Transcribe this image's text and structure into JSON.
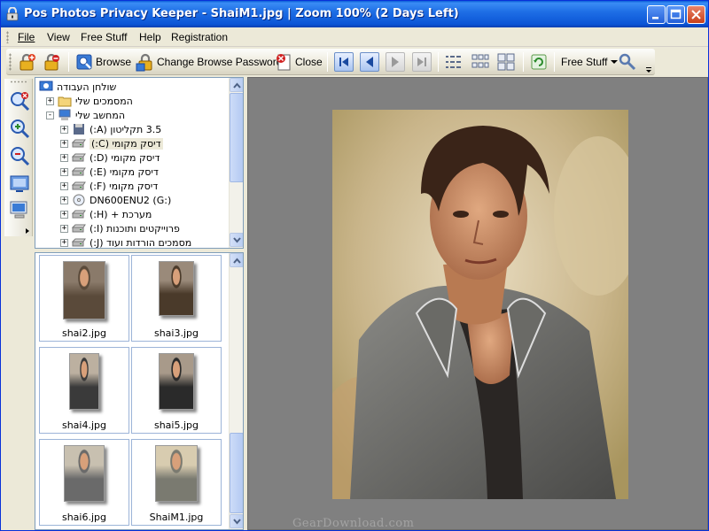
{
  "window": {
    "title": "Pos Photos Privacy Keeper - ShaiM1.jpg | Zoom 100% (2 Days Left)"
  },
  "menu": [
    {
      "label": "File",
      "hotkey_index": 0
    },
    {
      "label": "View",
      "hotkey_index": 0
    },
    {
      "label": "Free Stuff",
      "hotkey_index": 0
    },
    {
      "label": "Help",
      "hotkey_index": 0
    },
    {
      "label": "Registration",
      "hotkey_index": 0
    }
  ],
  "toolbar": {
    "browse_label": "Browse",
    "change_password_label": "Change Browse Password",
    "close_label": "Close",
    "free_stuff_label": "Free Stuff",
    "icons": [
      "lock-add-icon",
      "lock-remove-icon",
      "browse-icon",
      "change-password-icon",
      "close-doc-icon",
      "first-icon",
      "prev-icon",
      "next-icon",
      "last-icon",
      "list-view-icon",
      "thumbs-view-icon",
      "large-thumbs-icon",
      "refresh-icon",
      "tools-icon"
    ]
  },
  "side_toolbar": {
    "icons": [
      "zoom-fit-icon",
      "zoom-in-icon",
      "zoom-out-icon",
      "view-fullscreen-icon",
      "computer-icon"
    ]
  },
  "tree": {
    "items": [
      {
        "label": "שולחן העבודה",
        "icon": "desktop-icon",
        "expander": "",
        "level": 0
      },
      {
        "label": "המסמכים שלי",
        "icon": "folder-icon",
        "expander": "+",
        "level": 1
      },
      {
        "label": "המחשב שלי",
        "icon": "computer-icon",
        "expander": "-",
        "level": 1
      },
      {
        "label": "3.5 תקליטון (A:)",
        "icon": "floppy-icon",
        "expander": "+",
        "level": 2
      },
      {
        "label": "דיסק מקומי (C:)",
        "icon": "drive-icon",
        "expander": "+",
        "level": 2,
        "selected": true
      },
      {
        "label": "דיסק מקומי (D:)",
        "icon": "drive-icon",
        "expander": "+",
        "level": 2
      },
      {
        "label": "דיסק מקומי (E:)",
        "icon": "drive-icon",
        "expander": "+",
        "level": 2
      },
      {
        "label": "דיסק מקומי (F:)",
        "icon": "drive-icon",
        "expander": "+",
        "level": 2
      },
      {
        "label": "DN600ENU2 (G:)",
        "icon": "cd-icon",
        "expander": "+",
        "level": 2
      },
      {
        "label": "מערכת + (H:)",
        "icon": "drive-icon",
        "expander": "+",
        "level": 2
      },
      {
        "label": "פרוייקטים ותוכנות (I:)",
        "icon": "drive-icon",
        "expander": "+",
        "level": 2
      },
      {
        "label": "מסמכים הורדות ועוד (J:)",
        "icon": "drive-icon",
        "expander": "+",
        "level": 2
      }
    ]
  },
  "thumbnails": [
    {
      "name": "shai2.jpg"
    },
    {
      "name": "shai3.jpg"
    },
    {
      "name": "shai4.jpg"
    },
    {
      "name": "shai5.jpg"
    },
    {
      "name": "shai6.jpg"
    },
    {
      "name": "ShaiM1.jpg"
    }
  ],
  "preview": {
    "watermark": "GearDownload.com"
  },
  "colors": {
    "title_bar": "#0a5fd8",
    "preview_bg": "#808080",
    "selection": "#ece9d8"
  }
}
